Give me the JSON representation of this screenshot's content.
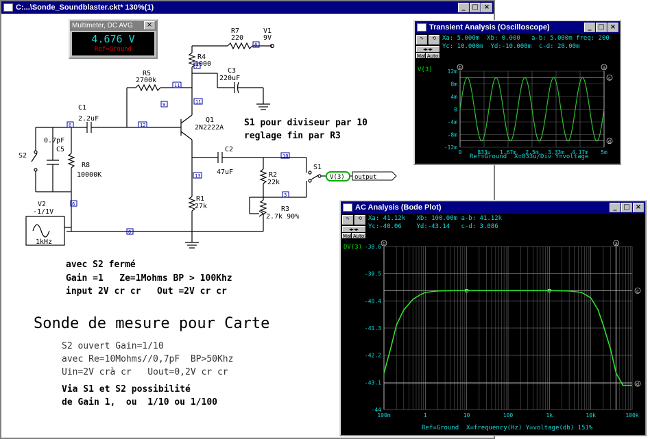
{
  "main_window": {
    "title": "C:...\\Sonde_Soundblaster.ckt* 130%(1)",
    "buttons": [
      "_",
      "□",
      "×"
    ]
  },
  "multimeter": {
    "title": "Multimeter, DC AVG",
    "value": "4.676 V",
    "reference": "Ref=Ground",
    "close": "×"
  },
  "schematic": {
    "components": {
      "r7": {
        "name": "R7",
        "value": "220"
      },
      "v1": {
        "name": "V1",
        "value": "9V"
      },
      "r4": {
        "name": "R4",
        "value": "1000"
      },
      "c3": {
        "name": "C3",
        "value": "220uF"
      },
      "r5": {
        "name": "R5",
        "value": "2700k"
      },
      "c1": {
        "name": "C1",
        "value": "2.2uF"
      },
      "q1": {
        "name": "Q1",
        "value": "2N2222A"
      },
      "s2": {
        "name": "S2"
      },
      "c5": {
        "name": "C5",
        "value": "0.7pF"
      },
      "r8": {
        "name": "R8",
        "value": "10000K"
      },
      "c2": {
        "name": "C2",
        "value": "47uF"
      },
      "r2": {
        "name": "R2",
        "value": "22k"
      },
      "s1": {
        "name": "S1"
      },
      "r1": {
        "name": "R1",
        "value": "27k"
      },
      "r3": {
        "name": "R3",
        "value": "2.7k 90%"
      },
      "v2": {
        "name": "V2",
        "value": "-1/1V",
        "freq": "1kHz"
      }
    },
    "nodes": [
      "8",
      "7",
      "11",
      "9",
      "11",
      "6",
      "12",
      "13",
      "10",
      "3",
      "6",
      "0"
    ],
    "probe_label": "V(3)",
    "output_label": "output",
    "notes": {
      "s1_line1": "S1 pour diviseur par 10",
      "s1_line2": "reglage fin par R3",
      "s2_closed_1": "avec S2 fermé",
      "s2_closed_2": "Gain =1   Ze=1Mohms BP > 100Khz",
      "s2_closed_3": "input 2V cr cr   Out =2V cr cr",
      "heading": "Sonde de mesure pour Carte",
      "s2_open_1": "S2 ouvert Gain=1/10",
      "s2_open_2": "avec Re=10Mohms//0,7pF  BP>50Khz",
      "s2_open_3": "Uin=2V crà cr   Uout=0,2V cr cr",
      "via_1": "Via S1 et S2 possibilité",
      "via_2": "de Gain 1,  ou  1/10 ou 1/100"
    }
  },
  "transient": {
    "title": "Transient Analysis (Oscilloscope)",
    "readout_line1": "Xa: 5.000m  Xb: 0.000   a-b: 5.000m freq: 200",
    "readout_line2": "Yc: 10.000m  Yd:-10.000m  c-d: 20.00m",
    "trace_name": "V(3)",
    "y_ticks": [
      "12m",
      "8m",
      "4m",
      "0",
      "-4m",
      "-8m",
      "-12m"
    ],
    "x_ticks": [
      "0",
      "833u",
      "1.67m",
      "2.5m",
      "3.33m",
      "4.17m",
      "5m"
    ],
    "footer": "Ref=Ground  X=833u/Div Y=voltage",
    "tools": [
      "Mat",
      "Auto"
    ],
    "cursor_labels": [
      "b",
      "a",
      "c",
      "d"
    ],
    "color": "#30c030"
  },
  "ac": {
    "title": "AC Analysis (Bode Plot)",
    "readout_line1": "Xa: 41.12k   Xb: 100.00m a-b: 41.12k",
    "readout_line2": "Yc:-40.06    Yd:-43.14   c-d: 3.086",
    "trace_name": "DV(3)",
    "y_ticks": [
      "-38.6",
      "-39.5",
      "-40.4",
      "-41.3",
      "-42.2",
      "-43.1",
      "-44"
    ],
    "x_ticks": [
      "100m",
      "1",
      "10",
      "100",
      "1k",
      "10k",
      "100k"
    ],
    "footer": "Ref=Ground  X=frequency(Hz) Y=voltage(db) 151%",
    "tools": [
      "Mat",
      "Auto"
    ],
    "cursor_labels": [
      "b",
      "a",
      "c",
      "d"
    ],
    "color": "#30e030"
  },
  "chart_data": [
    {
      "type": "line",
      "title": "Transient Analysis (Oscilloscope)",
      "xlabel": "X=833u/Div",
      "ylabel": "Y=voltage",
      "xlim": [
        0,
        0.005
      ],
      "ylim": [
        -0.012,
        0.012
      ],
      "series": [
        {
          "name": "V(3)",
          "description_values": "sine, amplitude 10m, 5 cycles over 5m (1kHz)",
          "x": [
            0,
            0.00025,
            0.0005,
            0.00075,
            0.001,
            0.00125,
            0.0015,
            0.00175,
            0.002,
            0.00225,
            0.0025,
            0.00275,
            0.003,
            0.00325,
            0.0035,
            0.00375,
            0.004,
            0.00425,
            0.0045,
            0.00475,
            0.005
          ],
          "values": [
            0,
            0.01,
            0,
            -0.01,
            0,
            0.01,
            0,
            -0.01,
            0,
            0.01,
            0,
            -0.01,
            0,
            0.01,
            0,
            -0.01,
            0,
            0.01,
            0,
            -0.01,
            0
          ]
        }
      ]
    },
    {
      "type": "line",
      "title": "AC Analysis (Bode Plot)",
      "xlabel": "X=frequency(Hz)",
      "ylabel": "Y=voltage(db)",
      "xscale": "log",
      "xlim": [
        0.1,
        100000
      ],
      "ylim": [
        -44,
        -38.6
      ],
      "series": [
        {
          "name": "DV(3)",
          "x": [
            0.1,
            0.15,
            0.2,
            0.3,
            0.5,
            0.7,
            1,
            2,
            5,
            10,
            100,
            1000,
            3000,
            6000,
            10000,
            15000,
            20000,
            30000,
            41120,
            60000,
            100000
          ],
          "values": [
            -42.8,
            -41.9,
            -41.2,
            -40.7,
            -40.35,
            -40.22,
            -40.12,
            -40.07,
            -40.06,
            -40.06,
            -40.06,
            -40.06,
            -40.07,
            -40.12,
            -40.3,
            -40.7,
            -41.2,
            -42.0,
            -42.8,
            -43.2,
            -43.2
          ]
        }
      ]
    }
  ]
}
